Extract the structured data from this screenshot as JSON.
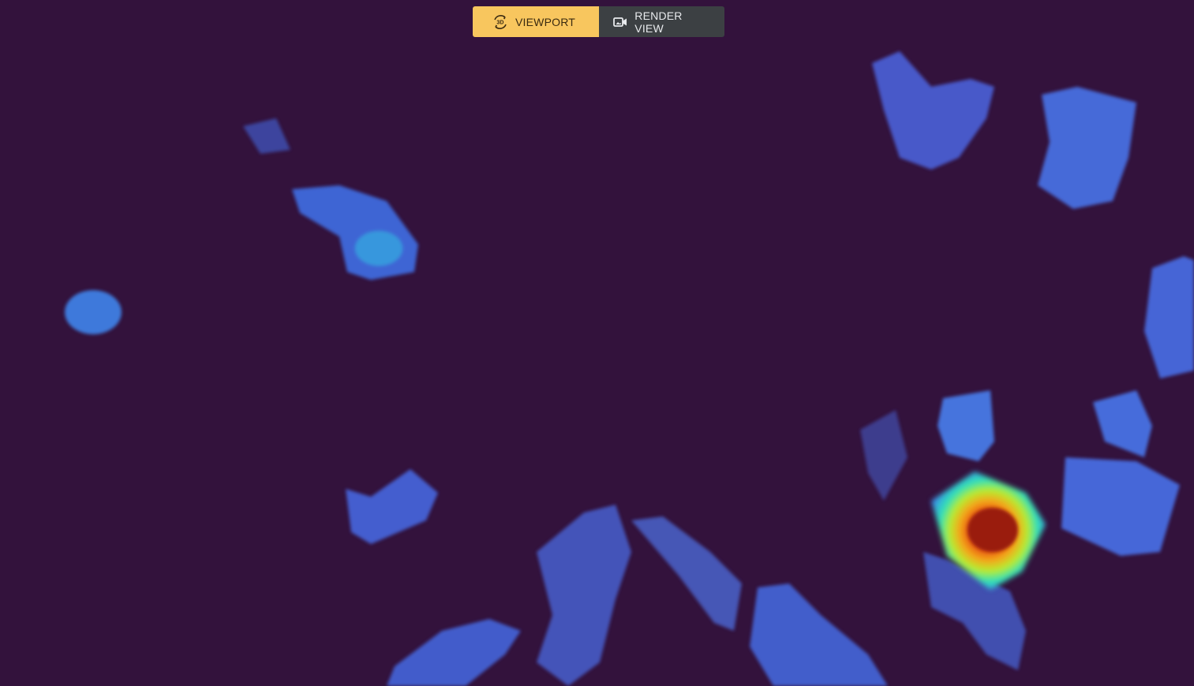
{
  "view_toggle": {
    "viewport_label": "VIEWPORT",
    "render_label": "RENDER VIEW",
    "active": "viewport",
    "viewport_icon": "3d-rotate-icon",
    "render_icon": "video-camera-icon"
  },
  "render": {
    "description_colormap": "turbo",
    "background_color": "#33123c",
    "accent_color": "#f8c65e"
  }
}
